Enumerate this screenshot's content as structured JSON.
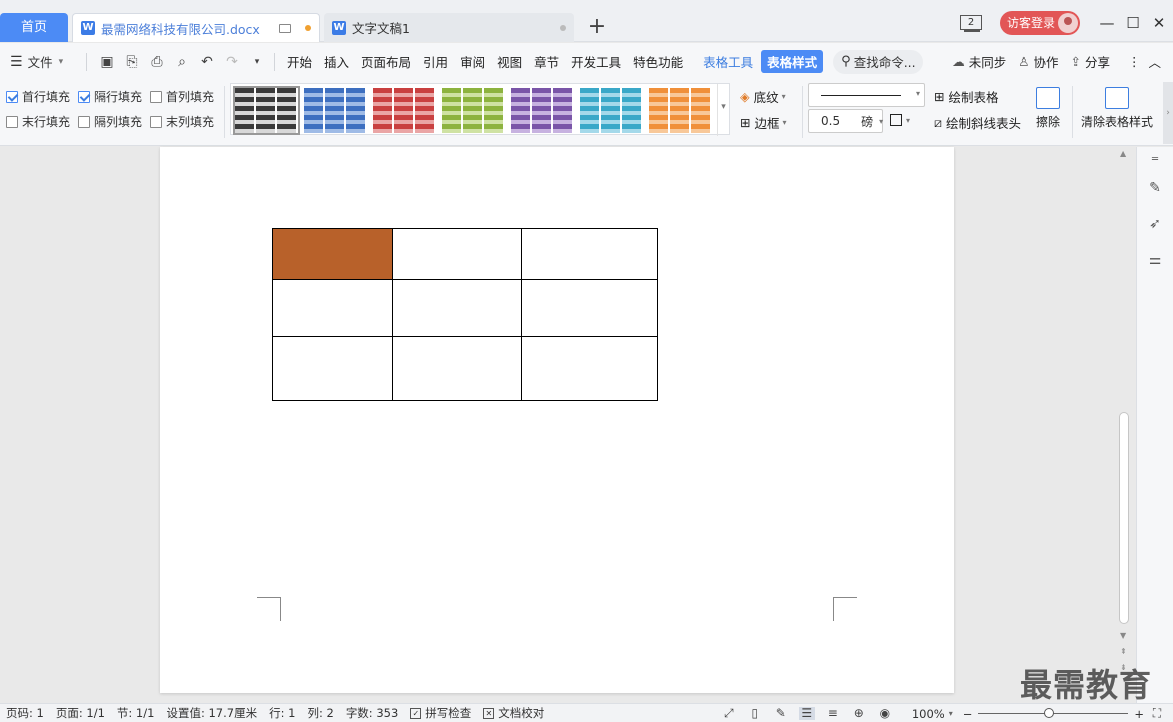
{
  "tabs": {
    "home": "首页",
    "active_doc": "最需网络科技有限公司.docx",
    "second_doc": "文字文稿1",
    "new_tab": "+"
  },
  "window": {
    "count": "2",
    "login": "访客登录",
    "minimize": "—",
    "maximize": "☐",
    "close": "✕"
  },
  "menu": {
    "file": "文件",
    "items": [
      "开始",
      "插入",
      "页面布局",
      "引用",
      "审阅",
      "视图",
      "章节",
      "开发工具",
      "特色功能"
    ],
    "table_tools": "表格工具",
    "table_style": "表格样式",
    "search": "查找命令...",
    "unsynced": "未同步",
    "collab": "协作",
    "share": "分享"
  },
  "ribbon": {
    "checks": [
      {
        "label": "首行填充",
        "checked": true
      },
      {
        "label": "隔行填充",
        "checked": true
      },
      {
        "label": "首列填充",
        "checked": false
      },
      {
        "label": "末行填充",
        "checked": false
      },
      {
        "label": "隔列填充",
        "checked": false
      },
      {
        "label": "末列填充",
        "checked": false
      }
    ],
    "styles": [
      {
        "color": "#3a3a3a",
        "light": "#d8d8d8"
      },
      {
        "color": "#3d6fc0",
        "light": "#9fbbe6"
      },
      {
        "color": "#c94040",
        "light": "#eaa5a5"
      },
      {
        "color": "#8db33f",
        "light": "#cfe2a3"
      },
      {
        "color": "#7a55a8",
        "light": "#c7b2e0"
      },
      {
        "color": "#3aa8c8",
        "light": "#a4d9ea"
      },
      {
        "color": "#f0903a",
        "light": "#f8c899"
      }
    ],
    "shading": "底纹",
    "border": "边框",
    "line_weight": "0.5",
    "line_unit": "磅",
    "draw_table": "绘制表格",
    "draw_diagonal": "绘制斜线表头",
    "eraser": "擦除",
    "clear_style": "清除表格样式"
  },
  "document": {
    "table": {
      "rows": 3,
      "cols": 3,
      "highlight_color": "#b8612a",
      "highlight_cell": [
        0,
        0
      ]
    }
  },
  "status": {
    "page_num": "页码: 1",
    "pages": "页面: 1/1",
    "section": "节: 1/1",
    "setting": "设置值: 17.7厘米",
    "row": "行: 1",
    "col": "列: 2",
    "words": "字数: 353",
    "spell": "拼写检查",
    "proof": "文档校对",
    "zoom": "100%"
  },
  "watermark": "最需教育"
}
